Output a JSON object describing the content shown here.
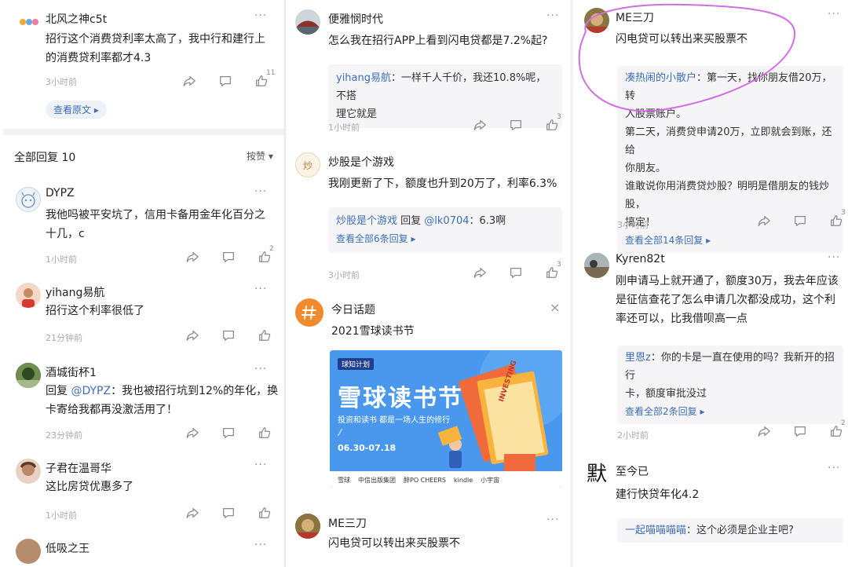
{
  "col1": {
    "top_post": {
      "user": "北风之神c5t",
      "line1": "招行这个消费贷利率太高了，我中行和建行上",
      "line2": "的消费贷利率都才4.3",
      "time": "3小时前",
      "likes": "11",
      "view_original": "查看原文"
    },
    "replies_header": {
      "title": "全部回复 10",
      "sort": "按赞"
    },
    "comments": [
      {
        "user": "DYPZ",
        "line1": "我他吗被平安坑了，信用卡备用金年化百分之",
        "line2": "十几，c",
        "time": "1小时前",
        "likes": "2"
      },
      {
        "user": "yihang易航",
        "line1": "招行这个利率很低了",
        "time": "21分钟前"
      },
      {
        "user": "酒城街杯1",
        "line1_prefix": "回复 ",
        "mention": "@DYPZ",
        "line1_rest": "：我也被招行坑到12%的年化，换",
        "line2": "卡寄给我都再没激活用了！",
        "time": "23分钟前"
      },
      {
        "user": "子君在温哥华",
        "line1": "这比房贷优惠多了",
        "time": "1小时前"
      },
      {
        "user": "低吸之王"
      }
    ]
  },
  "col2": {
    "post1": {
      "user": "便雅悯时代",
      "line1": "怎么我在招行APP上看到闪电贷都是7.2%起?",
      "quote_user": "yihang易航",
      "quote_text1": "：一样千人千价，我还10.8%呢，不搭",
      "quote_text2": "理它就是",
      "time": "1小时前",
      "likes": "3"
    },
    "post2": {
      "user": "炒股是个游戏",
      "line1": "我刚更新了下，额度也升到20万了，利率6.3%",
      "quote_user": "炒股是个游戏",
      "quote_mid": " 回复 ",
      "quote_mention": "@lk0704",
      "quote_rest": "：6.3啊",
      "quote_more": "查看全部6条回复",
      "time": "3小时前",
      "likes": "3"
    },
    "topic": {
      "label": "今日话题",
      "title": "2021雪球读书节"
    },
    "banner": {
      "tag": "球知计划",
      "headline": "雪球读书节",
      "sub": "投资和读书 都是一场人生的修行",
      "dates": "06.30-07.18",
      "book": "INVESTING",
      "sponsors": [
        "雪球",
        "中信出版集团",
        "醉PO CHEERS",
        "kindle",
        "小宇宙"
      ]
    },
    "post3": {
      "user": "ME三刀",
      "line1": "闪电贷可以转出来买股票不"
    }
  },
  "col3": {
    "post1": {
      "user": "ME三刀",
      "line1": "闪电贷可以转出来买股票不",
      "quote_user": "凑热闹的小散户",
      "quote_l1": "：第一天，找你朋友借20万，转",
      "quote_l2": "入股票账户。",
      "quote_l3": "第二天，消费贷申请20万，立即就会到账，还给",
      "quote_l4": "你朋友。",
      "quote_l5": "谁敢说你用消费贷炒股？明明是借朋友的钱炒股，",
      "quote_l6": "搞定！",
      "quote_more": "查看全部14条回复",
      "time": "3小时前",
      "likes": "3"
    },
    "post2": {
      "user": "Kyren82t",
      "line1": "刚申请马上就开通了，额度30万，我去年应该",
      "line2": "是征信查花了怎么申请几次都没成功，这个利",
      "line3": "率还可以，比我借呗高一点",
      "quote_user": "里恩z",
      "quote_l1": "：你的卡是一直在使用的吗？我新开的招行",
      "quote_l2": "卡，额度审批没过",
      "quote_more": "查看全部2条回复",
      "time": "2小时前",
      "likes": "2"
    },
    "post3": {
      "user": "至今已",
      "avatar_char": "默",
      "line1": "建行快贷年化4.2",
      "quote_user": "一起喵喵喵喵",
      "quote_rest": "：这个必须是企业主吧?"
    }
  },
  "icons": {
    "share": "share-icon",
    "comment": "comment-icon",
    "like": "thumb-up-icon",
    "more": "more-dots-icon",
    "close": "close-icon"
  },
  "colors": {
    "link": "#3c6fb6",
    "circle": "#cf6fe0",
    "banner_bg": "#3f8ee8",
    "topic_icon": "#f08a2c"
  }
}
